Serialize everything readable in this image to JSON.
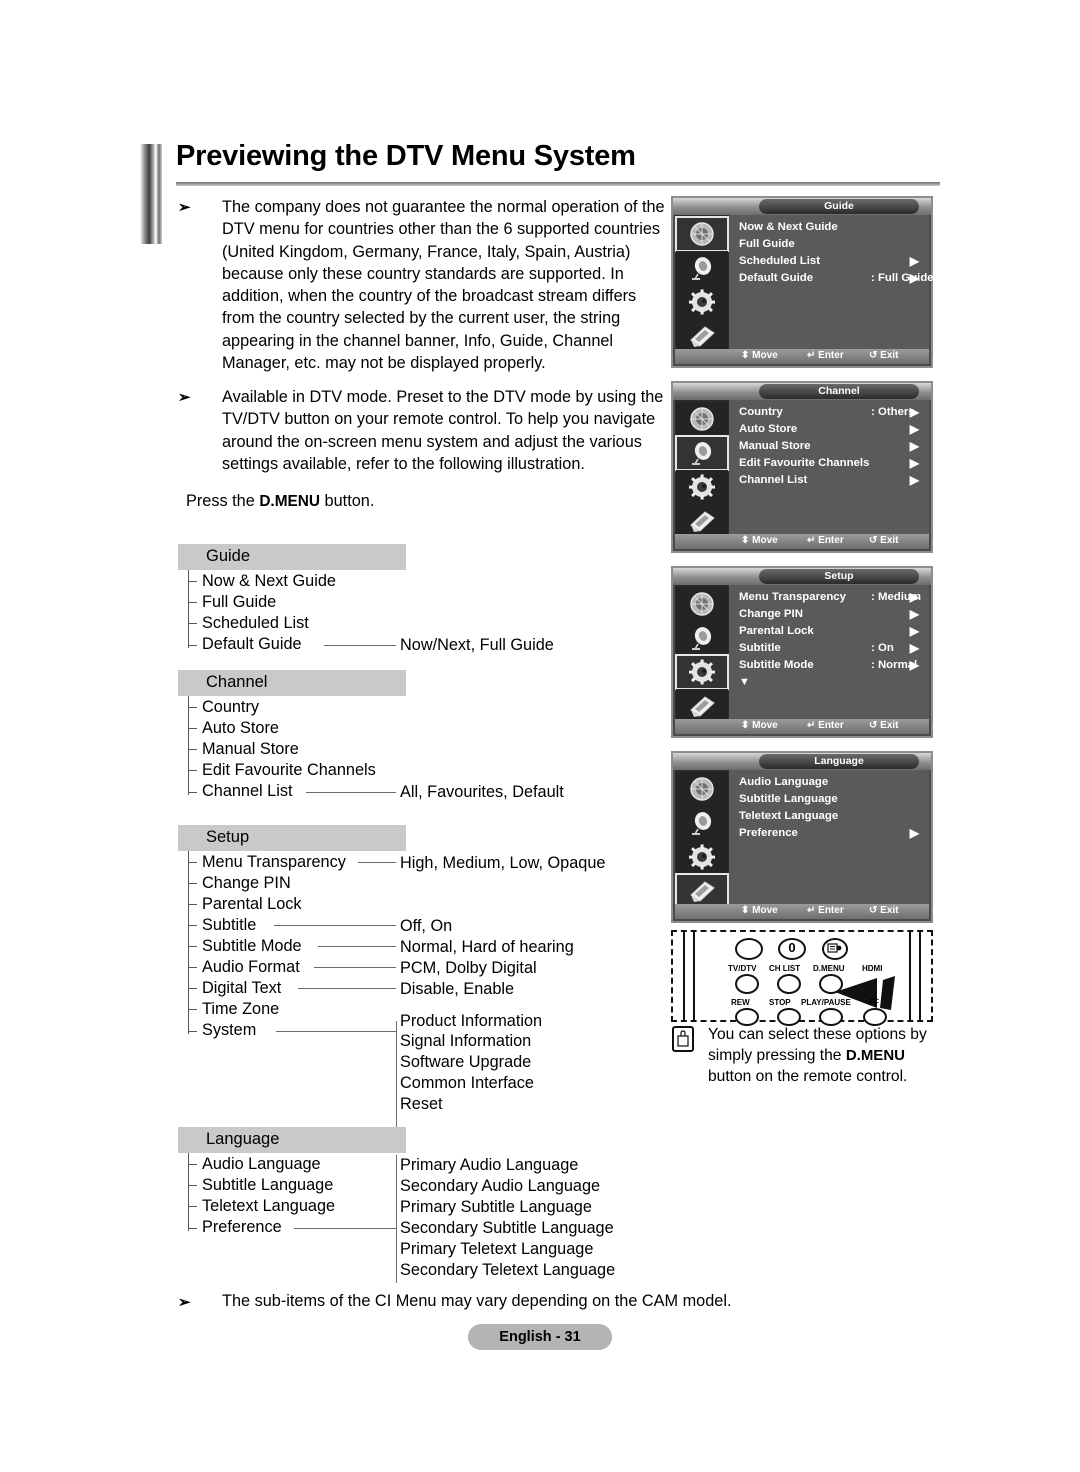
{
  "page": {
    "title": "Previewing the DTV Menu System",
    "footer_note": "The sub-items of the CI Menu may vary depending on the CAM model.",
    "page_label": "English - 31"
  },
  "intro": {
    "bullet1": "The company does not guarantee the normal operation of the DTV menu for countries other than the 6 supported countries (United Kingdom, Germany, France, Italy, Spain, Austria) because only these country standards are supported. In addition, when the country of the broadcast stream differs from the country selected by the current user, the string appearing in the channel banner, Info, Guide, Channel Manager, etc. may not be displayed properly.",
    "bullet2": "Available in DTV mode. Preset to the DTV mode by using the TV/DTV button on your remote control. To help you navigate around the on-screen menu system and adjust the various settings available, refer to the following illustration.",
    "press_prefix": "Press the ",
    "press_key": "D.MENU",
    "press_suffix": " button.",
    "arrow_glyph": "➢"
  },
  "tree": {
    "guide": {
      "header": "Guide",
      "items": [
        "Now & Next Guide",
        "Full Guide",
        "Scheduled List",
        "Default Guide"
      ],
      "values": [
        "Now/Next, Full Guide"
      ]
    },
    "channel": {
      "header": "Channel",
      "items": [
        "Country",
        "Auto Store",
        "Manual Store",
        "Edit Favourite Channels",
        "Channel List"
      ],
      "values": [
        "All, Favourites, Default"
      ]
    },
    "setup": {
      "header": "Setup",
      "items": [
        "Menu Transparency",
        "Change PIN",
        "Parental Lock",
        "Subtitle",
        "Subtitle Mode",
        "Audio Format",
        "Digital Text",
        "Time Zone",
        "System"
      ],
      "value_transparency": "High, Medium, Low, Opaque",
      "value_subtitle": "Off, On",
      "value_subtitle_mode": "Normal, Hard of hearing",
      "value_audio_format": "PCM, Dolby Digital",
      "value_digital_text": "Disable, Enable",
      "system_subitems": [
        "Product Information",
        "Signal Information",
        "Software Upgrade",
        "Common Interface",
        "Reset"
      ]
    },
    "language": {
      "header": "Language",
      "items": [
        "Audio Language",
        "Subtitle Language",
        "Teletext Language",
        "Preference"
      ],
      "preference_subitems": [
        "Primary Audio Language",
        "Secondary Audio Language",
        "Primary Subtitle Language",
        "Secondary Subtitle Language",
        "Primary Teletext Language",
        "Secondary Teletext Language"
      ]
    }
  },
  "osd": {
    "hints": {
      "move": "Move",
      "enter": "Enter",
      "exit": "Exit",
      "move_glyph": "⬍",
      "enter_glyph": "↵",
      "exit_glyph": "↺"
    },
    "arrow_glyph": "▶",
    "down_glyph": "▼",
    "sidebar_icons": [
      "guide-icon",
      "satellite-dish-icon",
      "gear-icon",
      "language-icon"
    ],
    "panels": [
      {
        "title": "Guide",
        "selected_icon": 0,
        "rows": [
          {
            "label": "Now & Next Guide",
            "value": "",
            "arrow": false
          },
          {
            "label": "Full Guide",
            "value": "",
            "arrow": false
          },
          {
            "label": "Scheduled List",
            "value": "",
            "arrow": true
          },
          {
            "label": "Default Guide",
            "value": ": Full Guide",
            "arrow": true
          }
        ],
        "more": false
      },
      {
        "title": "Channel",
        "selected_icon": 1,
        "rows": [
          {
            "label": "Country",
            "value": ": Others",
            "arrow": true
          },
          {
            "label": "Auto Store",
            "value": "",
            "arrow": true
          },
          {
            "label": "Manual Store",
            "value": "",
            "arrow": true
          },
          {
            "label": "Edit Favourite Channels",
            "value": "",
            "arrow": true
          },
          {
            "label": "Channel List",
            "value": "",
            "arrow": true
          }
        ],
        "more": false
      },
      {
        "title": "Setup",
        "selected_icon": 2,
        "rows": [
          {
            "label": "Menu Transparency",
            "value": ": Medium",
            "arrow": true
          },
          {
            "label": "Change PIN",
            "value": "",
            "arrow": true
          },
          {
            "label": "Parental Lock",
            "value": "",
            "arrow": true
          },
          {
            "label": "Subtitle",
            "value": ": On",
            "arrow": true
          },
          {
            "label": "Subtitle  Mode",
            "value": ": Normal",
            "arrow": true
          }
        ],
        "more": true
      },
      {
        "title": "Language",
        "selected_icon": 3,
        "rows": [
          {
            "label": "Audio Language",
            "value": "",
            "arrow": false
          },
          {
            "label": "Subtitle Language",
            "value": "",
            "arrow": false
          },
          {
            "label": "Teletext Language",
            "value": "",
            "arrow": false
          },
          {
            "label": "Preference",
            "value": "",
            "arrow": true
          }
        ],
        "more": false
      }
    ]
  },
  "remote": {
    "labels_top": [
      "TV/DTV",
      "CH LIST",
      "D.MENU",
      "HDMI"
    ],
    "labels_bottom": [
      "REW",
      "STOP",
      "PLAY/PAUSE",
      "FF"
    ],
    "zero_key": "0"
  },
  "note": {
    "line1": "You can select these options",
    "line2": "by simply pressing the",
    "key": "D.MENU",
    "line3_suffix": " button on the",
    "line4": "remote control."
  }
}
